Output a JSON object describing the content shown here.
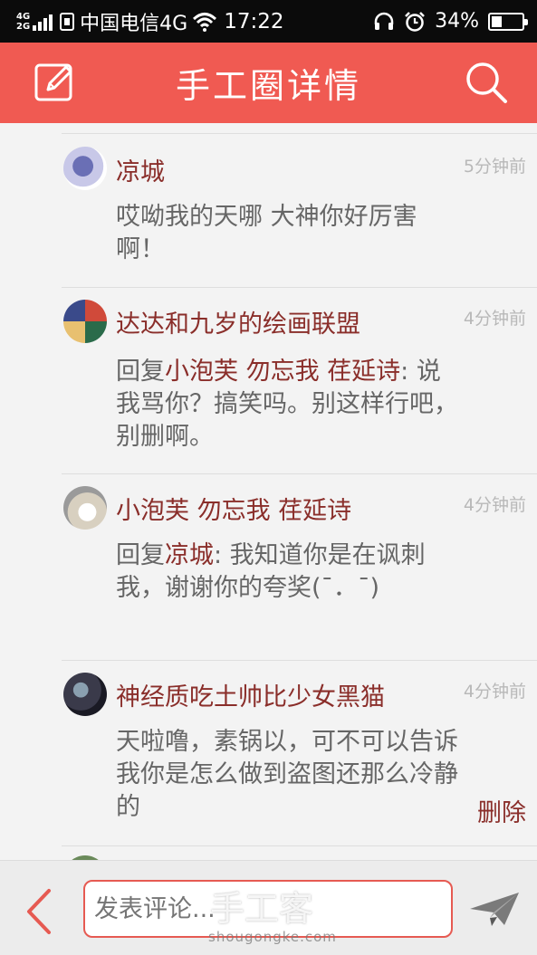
{
  "status_bar": {
    "network_top": "4G",
    "network_bottom": "2G",
    "carrier": "中国电信4G",
    "time": "17:22",
    "battery_text": "34%",
    "battery_level": 0.34
  },
  "header": {
    "title": "手工圈详情",
    "left_icon": "edit-icon",
    "right_icon": "search-icon",
    "background": "#f05a52"
  },
  "comments": [
    {
      "name": "凉城",
      "time": "5分钟前",
      "body_parts": [
        "哎呦我的天哪 大神你好厉害啊！"
      ],
      "avatar_colors": [
        "#6a6fb5",
        "#ffffff"
      ]
    },
    {
      "name": "达达和九岁的绘画联盟",
      "time": "4分钟前",
      "reply_prefix": "回复",
      "reply_to": "小泡芙  勿忘我 荏延诗",
      "reply_text": ": 说我骂你？搞笑吗。别这样行吧，别删啊。",
      "avatar_colors": [
        "#2a6b4a",
        "#d04a3a"
      ]
    },
    {
      "name": "小泡芙  勿忘我 荏延诗",
      "time": "4分钟前",
      "reply_prefix": "回复",
      "reply_to": "凉城",
      "reply_text": ": 我知道你是在讽刺我，谢谢你的夸奖(¯．¯)",
      "avatar_colors": [
        "#d8d0c0",
        "#9a9a9a"
      ]
    },
    {
      "name": "神经质吃土帅比少女黑猫",
      "time": "4分钟前",
      "body_parts": [
        "天啦噜，素锅以，可不可以告诉我你是怎么做到盗图还那么冷静的"
      ],
      "delete_label": "删除",
      "avatar_colors": [
        "#2a2a3a",
        "#8aa0b0"
      ]
    }
  ],
  "bottom_bar": {
    "input_placeholder": "发表评论...",
    "back_icon": "chevron-left-icon",
    "send_icon": "send-icon",
    "accent": "#e65a52"
  },
  "watermark": {
    "text": "手工客",
    "url": "shougongke.com"
  }
}
